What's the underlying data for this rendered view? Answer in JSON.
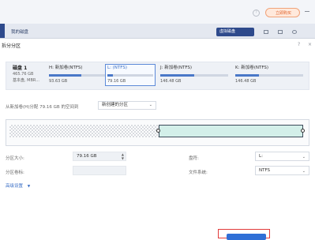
{
  "app": {
    "header_help_icon": "question-circle-icon",
    "vip_button_label": "立即购买",
    "section_label": "我的磁盘",
    "virtual_disk_button": "虚拟磁盘"
  },
  "dialog": {
    "title": "拆分分区",
    "help_label": "?",
    "close_label": "×",
    "disk": {
      "name": "磁盘 1",
      "size": "465.76 GB",
      "type": "基本盘, MBR..."
    },
    "partitions": [
      {
        "name": "H: 新加卷(NTFS)",
        "size": "93.63 GB",
        "used_fraction": 0.55,
        "selected": false
      },
      {
        "name": "L: (NTFS)",
        "size": "79.16 GB",
        "used_fraction": 0.12,
        "selected": true
      },
      {
        "name": "J: 新加卷(NTFS)",
        "size": "146.48 GB",
        "used_fraction": 0.5,
        "selected": false
      },
      {
        "name": "K: 新加卷(NTFS)",
        "size": "146.48 GB",
        "used_fraction": 0.35,
        "selected": false
      }
    ],
    "source_text": "从新加卷(H)分配 79.16 GB 的空间到",
    "target_select": "新创建的分区",
    "fields": {
      "size_label": "分区大小:",
      "size_value": "79.16 GB",
      "drive_label": "盘符:",
      "drive_value": "L:",
      "volume_label": "分区卷标:",
      "volume_value": "",
      "fs_label": "文件系统:",
      "fs_value": "NTFS"
    },
    "advanced_label": "高级设置",
    "colors": {
      "accent": "#2f6fd6",
      "new_partition": "#d3efe9",
      "highlight": "#e23b3b"
    }
  }
}
